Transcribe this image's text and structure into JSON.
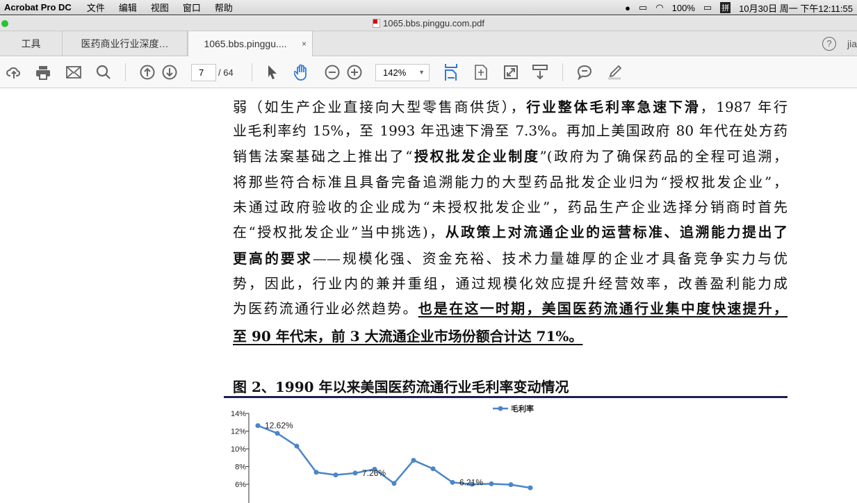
{
  "menubar": {
    "app": "Acrobat Pro DC",
    "items": [
      "文件",
      "编辑",
      "视图",
      "窗口",
      "帮助"
    ],
    "battery": "100%",
    "ime": "拼",
    "datetime": "10月30日 周一 下午12:11:55"
  },
  "window": {
    "title": "1065.bbs.pinggu.com.pdf"
  },
  "tabs": {
    "tools": "工具",
    "tab1": "医药商业行业深度…",
    "tab2": "1065.bbs.pinggu....",
    "close": "×",
    "help": "?",
    "user": "jia"
  },
  "toolbar": {
    "page": "7",
    "total": "/ 64",
    "zoom": "142%"
  },
  "doc": {
    "lines": [
      [
        {
          "t": "弱（如生产企业直接向大型零售商供货），"
        },
        {
          "t": "行业整体毛利率急速下滑",
          "b": 1
        },
        {
          "t": "，1987 年行"
        }
      ],
      [
        {
          "t": "业毛利率约 15%，至 1993 年迅速下滑至 7.3%。再加上美国政府 80 年代在处方药"
        }
      ],
      [
        {
          "t": "销售法案基础之上推出了“"
        },
        {
          "t": "授权批发企业制度",
          "b": 1
        },
        {
          "t": "”(政府为了确保药品的全程可追溯，"
        }
      ],
      [
        {
          "t": "将那些符合标准且具备完备追溯能力的大型药品批发企业归为“授权批发企业”，"
        }
      ],
      [
        {
          "t": "未通过政府验收的企业成为“未授权批发企业”，药品生产企业选择分销商时首先"
        }
      ],
      [
        {
          "t": "在“授权批发企业”当中挑选)，"
        },
        {
          "t": "从政策上对流通企业的运营标准、追溯能力提出了",
          "b": 1
        }
      ],
      [
        {
          "t": "更高的要求",
          "b": 1
        },
        {
          "t": "——规模化强、资金充裕、技术力量雄厚的企业才具备竞争实力与优"
        }
      ],
      [
        {
          "t": "势，因此，行业内的兼并重组，通过规模化效应提升经营效率，改善盈利能力成"
        }
      ],
      [
        {
          "t": "为医药流通行业必然趋势。"
        },
        {
          "t": "也是在这一时期，美国医药流通行业集中度快速提升，",
          "b": 1,
          "u": 1
        }
      ],
      [
        {
          "t": "至 90 年代末，前 3 大流通企业市场份额合计达 71%。",
          "b": 1,
          "u": 1
        }
      ]
    ],
    "figure_title": "图 2、1990 年以来美国医药流通行业毛利率变动情况"
  },
  "chart_data": {
    "type": "line",
    "title": "",
    "legend": [
      "毛利率"
    ],
    "legend_position": "top-right",
    "ylabel": "",
    "yticks": [
      "14%",
      "12%",
      "10%",
      "8%",
      "6%"
    ],
    "ylim": [
      6,
      14
    ],
    "series": [
      {
        "name": "毛利率",
        "color": "#4a86c8",
        "values": [
          12.62,
          11.75,
          10.3,
          7.35,
          7.05,
          7.26,
          7.7,
          6.1,
          8.7,
          7.75,
          6.21,
          6.0,
          6.05,
          5.95,
          5.6
        ]
      }
    ],
    "data_labels": [
      {
        "index": 0,
        "text": "12.62%"
      },
      {
        "index": 5,
        "text": "7.26%"
      },
      {
        "index": 10,
        "text": "6.21%"
      }
    ]
  }
}
